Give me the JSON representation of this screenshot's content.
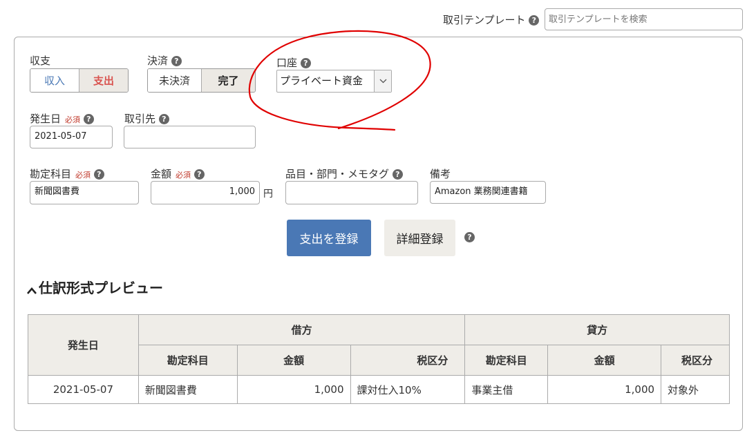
{
  "header": {
    "template_label": "取引テンプレート",
    "template_search_placeholder": "取引テンプレートを検索"
  },
  "colors": {
    "accent": "#4a78b5",
    "active_red": "#d9534f",
    "annotation_red": "#e00000"
  },
  "form": {
    "shushi": {
      "label": "収支",
      "options": [
        "収入",
        "支出"
      ],
      "selected": "支出"
    },
    "kessai": {
      "label": "決済",
      "options": [
        "未決済",
        "完了"
      ],
      "selected": "完了"
    },
    "account": {
      "label": "口座",
      "value": "プライベート資金"
    },
    "date": {
      "label": "発生日",
      "required": "必須",
      "value": "2021-05-07"
    },
    "partner": {
      "label": "取引先",
      "value": ""
    },
    "kamoku": {
      "label": "勘定科目",
      "required": "必須",
      "value": "新聞図書費"
    },
    "amount": {
      "label": "金額",
      "required": "必須",
      "value": "1,000",
      "unit": "円"
    },
    "item": {
      "label": "品目・部門・メモタグ",
      "value": ""
    },
    "memo": {
      "label": "備考",
      "value": "Amazon 業務関連書籍"
    },
    "submit_label": "支出を登録",
    "detail_label": "詳細登録"
  },
  "preview": {
    "title": "仕訳形式プレビュー",
    "headers": {
      "date": "発生日",
      "debit": "借方",
      "credit": "貸方",
      "kamoku": "勘定科目",
      "amount": "金額",
      "tax": "税区分"
    },
    "row": {
      "date": "2021-05-07",
      "debit_kamoku": "新聞図書費",
      "debit_amount": "1,000",
      "debit_tax": "課対仕入10%",
      "credit_kamoku": "事業主借",
      "credit_amount": "1,000",
      "credit_tax": "対象外"
    }
  }
}
